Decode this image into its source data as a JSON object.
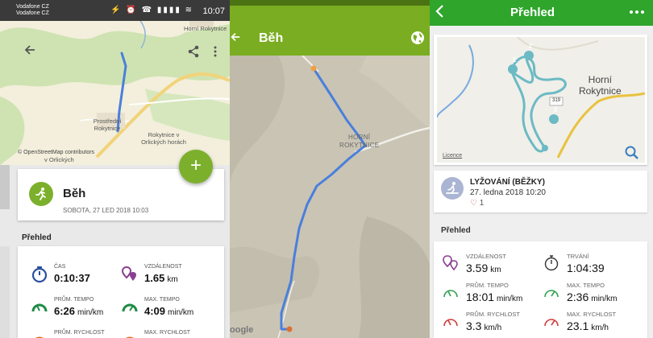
{
  "panel1": {
    "status_bar": {
      "carrier_1": "Vodafone CZ",
      "carrier_2": "Vodafone CZ",
      "icons": "⚡ ⏰ ☎ ▮▮▮▮ ≋",
      "time": "10:07"
    },
    "map": {
      "places": [
        "Horní Rokytnice",
        "Prostřední Rokytnice",
        "Rokytnice v Orlických horách",
        "v Orlických"
      ],
      "credit": "© OpenStreetMap contributors"
    },
    "back_icon": "back-arrow-icon",
    "share_icon": "share-icon",
    "more_icon": "more-vertical-icon",
    "fab_label": "+",
    "activity": {
      "name": "Běh",
      "date": "SOBOTA, 27 LED 2018 10:03"
    },
    "section_title": "Přehled",
    "stats": [
      {
        "label": "ČAS",
        "value": "0:10:37",
        "unit": "",
        "icon": "stopwatch-icon",
        "color": "#2b4fa0"
      },
      {
        "label": "VZDÁLENOST",
        "value": "1.65",
        "unit": "km",
        "icon": "route-pins-icon",
        "color": "#8a3f8f"
      },
      {
        "label": "PRŮM. TEMPO",
        "value": "6:26",
        "unit": "min/km",
        "icon": "gauge-icon",
        "color": "#1e8c45"
      },
      {
        "label": "MAX. TEMPO",
        "value": "4:09",
        "unit": "min/km",
        "icon": "gauge-icon",
        "color": "#1e8c45"
      },
      {
        "label": "PRŮM. RYCHLOST",
        "value": "",
        "unit": "",
        "icon": "gauge-icon",
        "color": "#e07020"
      },
      {
        "label": "MAX. RYCHLOST",
        "value": "",
        "unit": "",
        "icon": "gauge-icon",
        "color": "#e07020"
      }
    ]
  },
  "panel2": {
    "back_icon": "back-arrow-icon",
    "title": "Běh",
    "globe_icon": "globe-icon",
    "town": [
      "HORNÍ",
      "ROKYTNICE"
    ],
    "google_label": "oogle",
    "colors": {
      "bar": "#7aad21",
      "route": "#4a7fdc"
    }
  },
  "panel3": {
    "back_icon": "back-arrow-icon",
    "title": "Přehled",
    "more_icon": "more-horizontal-icon",
    "map": {
      "town": [
        "Horní",
        "Rokytnice"
      ],
      "road": "319",
      "markers": [
        "1",
        "2",
        "3"
      ],
      "licence": "Licence"
    },
    "activity": {
      "type": "LYŽOVÁNÍ (BĚŽKY)",
      "date": "27. ledna 2018 10:20",
      "likes": "1"
    },
    "section_title": "Přehled",
    "stats": [
      {
        "label": "VZDÁLENOST",
        "value": "3.59",
        "unit": "km",
        "icon": "route-pins-icon",
        "color": "#8a3f8f"
      },
      {
        "label": "TRVÁNÍ",
        "value": "1:04:39",
        "unit": "",
        "icon": "stopwatch-icon",
        "color": "#333333"
      },
      {
        "label": "PRŮM. TEMPO",
        "value": "18:01",
        "unit": "min/km",
        "icon": "gauge-icon",
        "color": "#2e9e4f"
      },
      {
        "label": "MAX. TEMPO",
        "value": "2:36",
        "unit": "min/km",
        "icon": "gauge-icon",
        "color": "#2e9e4f"
      },
      {
        "label": "PRŮM. RYCHLOST",
        "value": "3.3",
        "unit": "km/h",
        "icon": "gauge-icon",
        "color": "#d03a3a"
      },
      {
        "label": "MAX. RYCHLOST",
        "value": "23.1",
        "unit": "km/h",
        "icon": "gauge-icon",
        "color": "#d03a3a"
      }
    ]
  }
}
